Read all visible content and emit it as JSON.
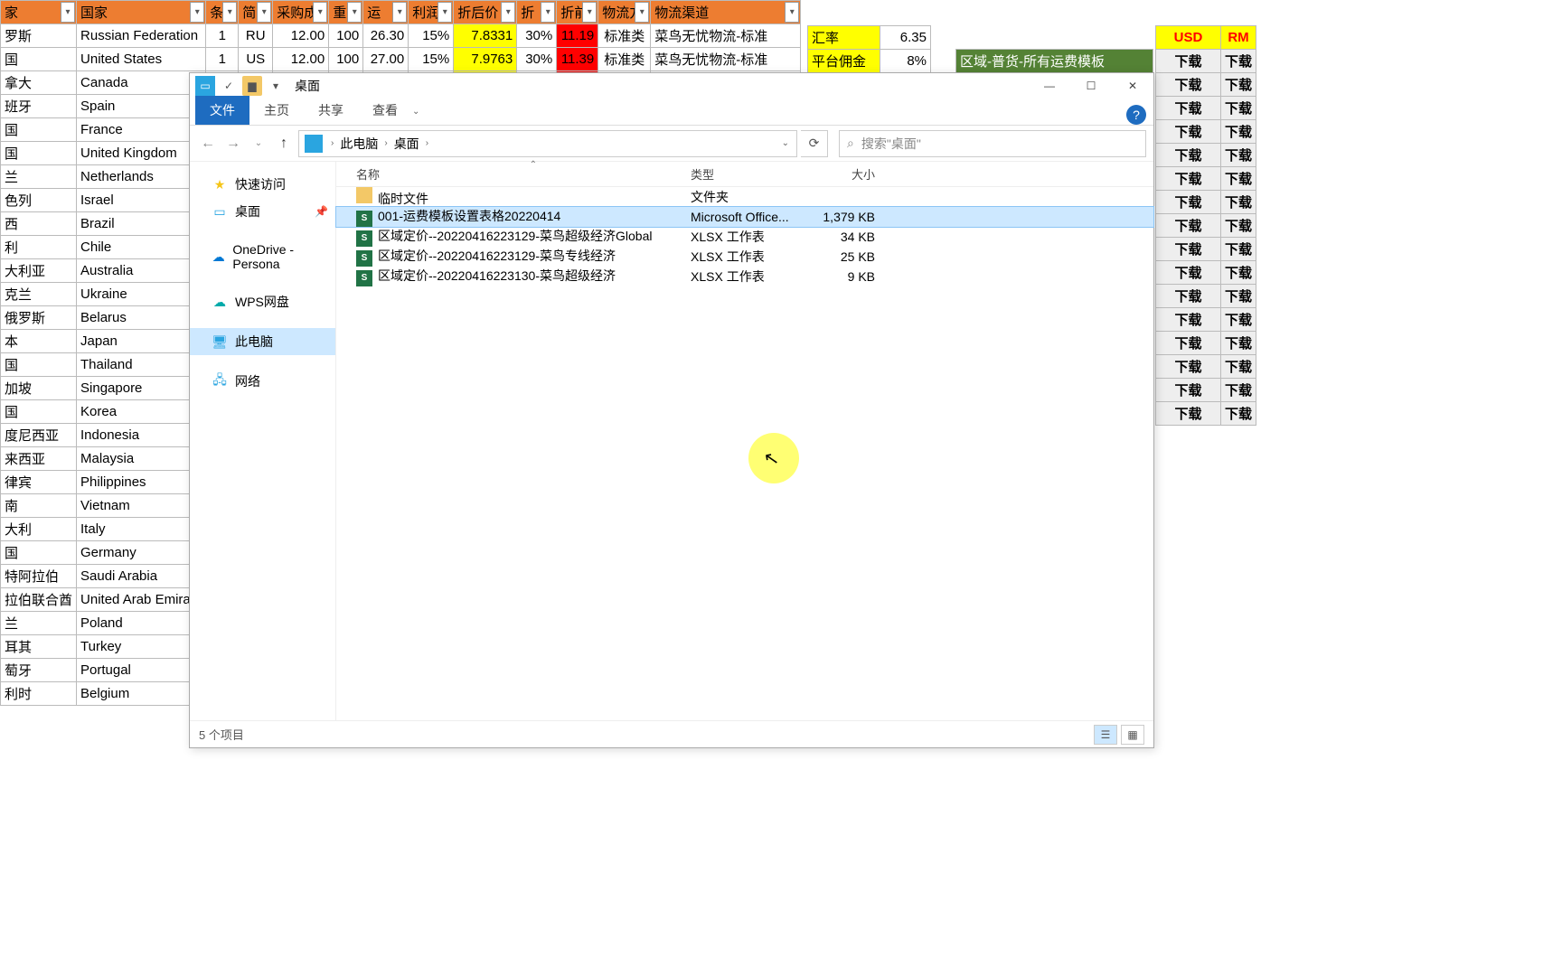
{
  "sheet": {
    "headers": [
      "家",
      "国家",
      "条",
      "简",
      "采购成",
      "重",
      "运",
      "利润",
      "折后价",
      "折",
      "折前",
      "物流方",
      "物流渠道"
    ],
    "rows": [
      {
        "c1": "罗斯",
        "c2": "Russian Federation",
        "tiao": "1",
        "short": "RU",
        "cost": "12.00",
        "w": "100",
        "ship": "26.30",
        "profit": "15%",
        "after": "7.8331",
        "disc": "30%",
        "before": "11.19",
        "type": "标准类",
        "chan": "菜鸟无忧物流-标准"
      },
      {
        "c1": "国",
        "c2": "United States",
        "tiao": "1",
        "short": "US",
        "cost": "12.00",
        "w": "100",
        "ship": "27.00",
        "profit": "15%",
        "after": "7.9763",
        "disc": "30%",
        "before": "11.39",
        "type": "标准类",
        "chan": "菜鸟无忧物流-标准"
      },
      {
        "c1": "拿大",
        "c2": "Canada"
      },
      {
        "c1": "班牙",
        "c2": "Spain"
      },
      {
        "c1": "国",
        "c2": "France"
      },
      {
        "c1": "国",
        "c2": "United Kingdom"
      },
      {
        "c1": "兰",
        "c2": "Netherlands"
      },
      {
        "c1": "色列",
        "c2": "Israel"
      },
      {
        "c1": "西",
        "c2": "Brazil"
      },
      {
        "c1": "利",
        "c2": "Chile"
      },
      {
        "c1": "大利亚",
        "c2": "Australia"
      },
      {
        "c1": "克兰",
        "c2": "Ukraine"
      },
      {
        "c1": "俄罗斯",
        "c2": "Belarus"
      },
      {
        "c1": "本",
        "c2": "Japan"
      },
      {
        "c1": "国",
        "c2": "Thailand"
      },
      {
        "c1": "加坡",
        "c2": "Singapore"
      },
      {
        "c1": "国",
        "c2": "Korea"
      },
      {
        "c1": "度尼西亚",
        "c2": "Indonesia"
      },
      {
        "c1": "来西亚",
        "c2": "Malaysia"
      },
      {
        "c1": "律宾",
        "c2": "Philippines"
      },
      {
        "c1": "南",
        "c2": "Vietnam"
      },
      {
        "c1": "大利",
        "c2": "Italy"
      },
      {
        "c1": "国",
        "c2": "Germany"
      },
      {
        "c1": "特阿拉伯",
        "c2": "Saudi Arabia"
      },
      {
        "c1": "拉伯联合酋",
        "c2": "United Arab Emirate"
      },
      {
        "c1": "兰",
        "c2": "Poland"
      },
      {
        "c1": "耳其",
        "c2": "Turkey"
      },
      {
        "c1": "萄牙",
        "c2": "Portugal"
      },
      {
        "c1": "利时",
        "c2": "Belgium"
      }
    ]
  },
  "right": {
    "rate_label": "汇率",
    "rate_val": "6.35",
    "comm_label": "平台佣金",
    "comm_val": "8%",
    "green": "区域-普货-所有运费模板",
    "usd": "USD",
    "rm": "RM",
    "download": "下载",
    "download2": "下载"
  },
  "explorer": {
    "title": "桌面",
    "ribbon": {
      "file": "文件",
      "home": "主页",
      "share": "共享",
      "view": "查看"
    },
    "crumbs": {
      "pc": "此电脑",
      "desk": "桌面"
    },
    "search_ph": "搜索\"桌面\"",
    "nav": {
      "quick": "快速访问",
      "desk": "桌面",
      "onedrive": "OneDrive - Persona",
      "wps": "WPS网盘",
      "pc": "此电脑",
      "net": "网络"
    },
    "listhdr": {
      "name": "名称",
      "type": "类型",
      "size": "大小"
    },
    "files": [
      {
        "icon": "folder",
        "name": "临时文件",
        "type": "文件夹",
        "size": ""
      },
      {
        "icon": "xls",
        "name": "001-运费模板设置表格20220414",
        "type": "Microsoft Office...",
        "size": "1,379 KB"
      },
      {
        "icon": "xls",
        "name": "区域定价--20220416223129-菜鸟超级经济Global",
        "type": "XLSX 工作表",
        "size": "34 KB"
      },
      {
        "icon": "xls",
        "name": "区域定价--20220416223129-菜鸟专线经济",
        "type": "XLSX 工作表",
        "size": "25 KB"
      },
      {
        "icon": "xls",
        "name": "区域定价--20220416223130-菜鸟超级经济",
        "type": "XLSX 工作表",
        "size": "9 KB"
      }
    ],
    "status": "5 个项目"
  }
}
